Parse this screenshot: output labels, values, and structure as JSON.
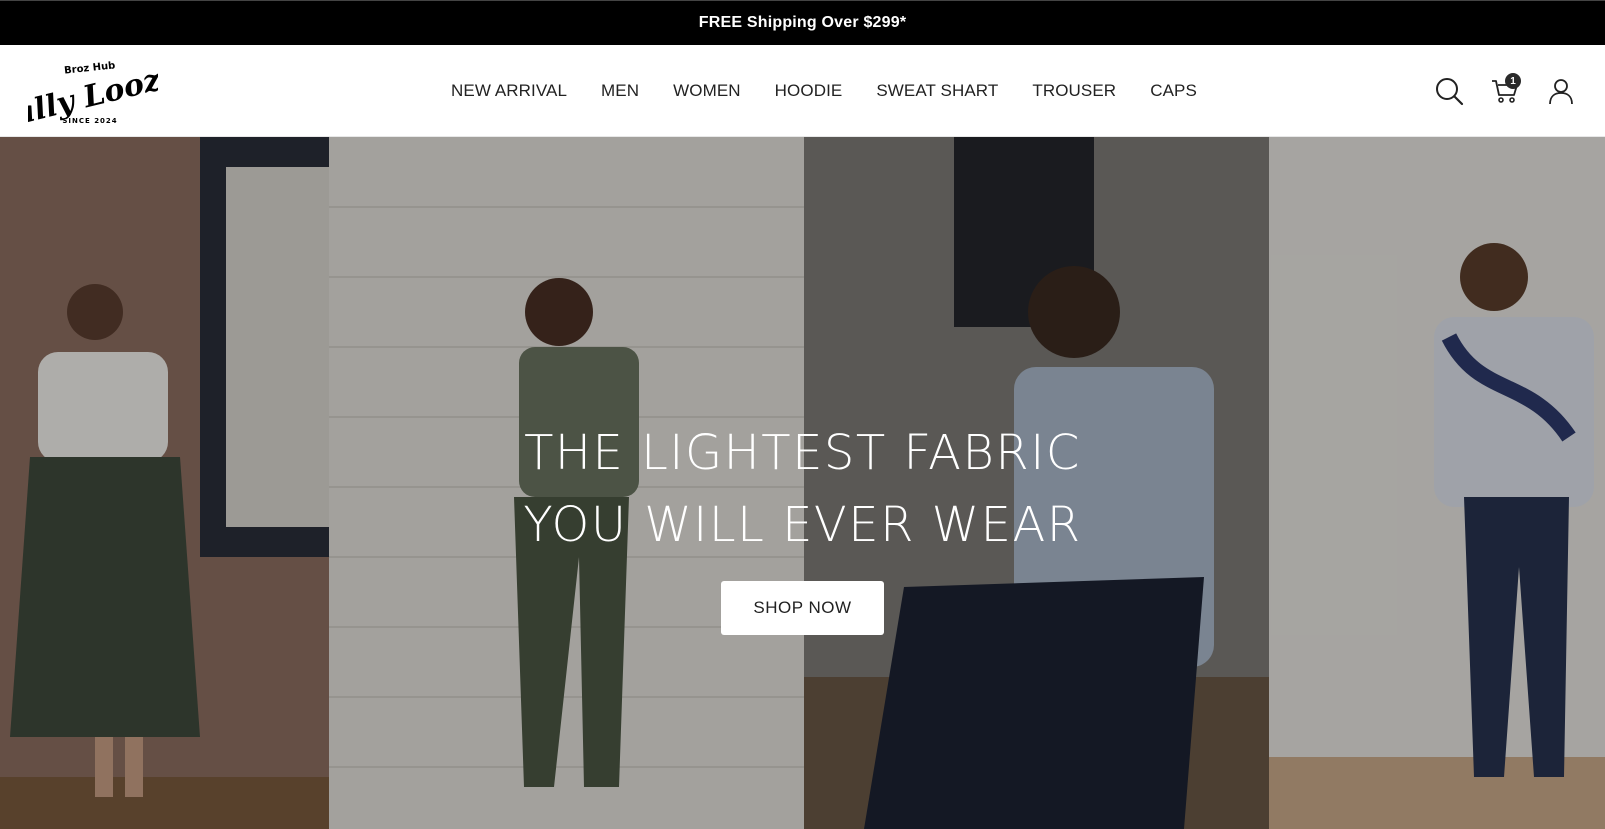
{
  "announcement": {
    "text": "FREE Shipping Over $299*"
  },
  "logo": {
    "top_text": "Broz Hub",
    "brand": "Sally Looze",
    "since": "SINCE 2024"
  },
  "nav": {
    "items": [
      {
        "label": "NEW ARRIVAL"
      },
      {
        "label": "MEN"
      },
      {
        "label": "WOMEN"
      },
      {
        "label": "HOODIE"
      },
      {
        "label": "SWEAT SHART"
      },
      {
        "label": "TROUSER"
      },
      {
        "label": "CAPS"
      }
    ]
  },
  "header_icons": {
    "search": "search-icon",
    "cart": "cart-icon",
    "cart_count": "1",
    "account": "user-icon"
  },
  "hero": {
    "headline_line1": "THE LIGHTEST FABRIC",
    "headline_line2": "YOU WILL EVER WEAR",
    "cta_label": "SHOP NOW"
  },
  "colors": {
    "announcement_bg": "#000000",
    "header_bg": "#ffffff",
    "text": "#222222",
    "cta_bg": "#ffffff"
  }
}
